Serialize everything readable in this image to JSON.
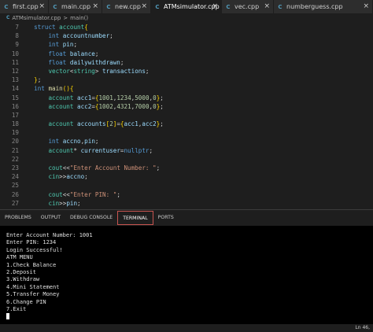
{
  "tabs": [
    {
      "label": "first.cpp",
      "active": false
    },
    {
      "label": "main.cpp",
      "active": false
    },
    {
      "label": "new.cpp",
      "active": false
    },
    {
      "label": "ATMsimulator.cpp",
      "active": true
    },
    {
      "label": "vec.cpp",
      "active": false
    },
    {
      "label": "numberguess.cpp",
      "active": false
    }
  ],
  "breadcrumb": {
    "file": "ATMsimulator.cpp",
    "sep": ">",
    "symbol": "main()"
  },
  "code": [
    {
      "n": "7",
      "t": "  struct account{"
    },
    {
      "n": "8",
      "t": "      int accountnumber;"
    },
    {
      "n": "9",
      "t": "      int pin;"
    },
    {
      "n": "10",
      "t": "      float balance;"
    },
    {
      "n": "11",
      "t": "      float dailywithdrawn;"
    },
    {
      "n": "12",
      "t": "      vector<string> transactions;"
    },
    {
      "n": "13",
      "t": "  };"
    },
    {
      "n": "14",
      "t": "  int main(){"
    },
    {
      "n": "15",
      "t": "      account acc1={1001,1234,5000,0};"
    },
    {
      "n": "16",
      "t": "      account acc2={1002,4321,7000,0};"
    },
    {
      "n": "17",
      "t": ""
    },
    {
      "n": "18",
      "t": "      account accounts[2]={acc1,acc2};"
    },
    {
      "n": "19",
      "t": ""
    },
    {
      "n": "20",
      "t": "      int accno,pin;"
    },
    {
      "n": "21",
      "t": "      account* currentuser=nullptr;"
    },
    {
      "n": "22",
      "t": ""
    },
    {
      "n": "23",
      "t": "      cout<<\"Enter Account Number: \";"
    },
    {
      "n": "24",
      "t": "      cin>>accno;"
    },
    {
      "n": "25",
      "t": ""
    },
    {
      "n": "26",
      "t": "      cout<<\"Enter PIN: \";"
    },
    {
      "n": "27",
      "t": "      cin>>pin;"
    },
    {
      "n": "28",
      "t": ""
    },
    {
      "n": "29",
      "t": "      for(int i=0;i<2;i++){"
    }
  ],
  "panel_tabs": [
    {
      "label": "PROBLEMS",
      "active": false
    },
    {
      "label": "OUTPUT",
      "active": false
    },
    {
      "label": "DEBUG CONSOLE",
      "active": false
    },
    {
      "label": "TERMINAL",
      "active": true
    },
    {
      "label": "PORTS",
      "active": false
    }
  ],
  "terminal_lines": [
    "Enter Account Number: 1001",
    "Enter PIN: 1234",
    "Login Successful!",
    "ATM MENU",
    "1.Check Balance",
    "2.Deposit",
    "3.Withdraw",
    "4.Mini Statement",
    "5.Transfer Money",
    "6.Change PIN",
    "7.Exit"
  ],
  "status": {
    "position": "Ln 46,"
  },
  "colors": {
    "keyword": "#569cd6",
    "type": "#4ec9b0",
    "string": "#ce9178",
    "number": "#b5cea8",
    "variable": "#9cdcfe",
    "bracket": "#ffd700"
  }
}
